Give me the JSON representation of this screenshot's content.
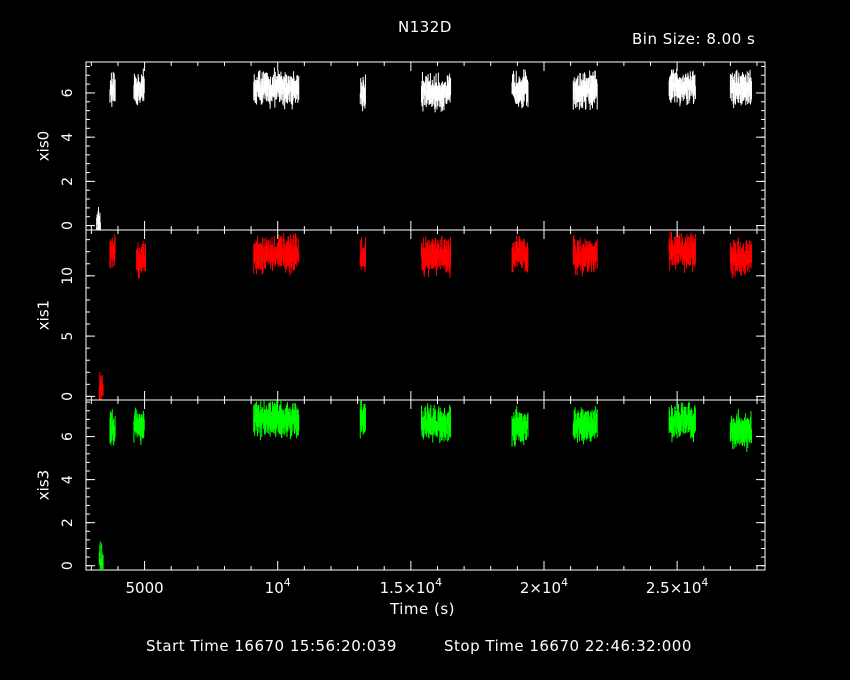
{
  "title": "N132D",
  "bin_label": "Bin Size: 8.00 s",
  "footer": {
    "start": "Start Time 16670 15:56:20:039",
    "stop": "Stop Time 16670 22:46:32:000"
  },
  "colors": {
    "xis0": "#ffffff",
    "xis1": "#ff0000",
    "xis3": "#00ff00"
  },
  "chart_data": {
    "type": "scatter",
    "title": "N132D",
    "xlabel": "Time (s)",
    "xlim": [
      2800,
      28300
    ],
    "x_ticks": [
      {
        "value": 5000,
        "base": "5000",
        "exp": ""
      },
      {
        "value": 10000,
        "base": "10",
        "exp": "4"
      },
      {
        "value": 15000,
        "base": "1.5×10",
        "exp": "4"
      },
      {
        "value": 20000,
        "base": "2×10",
        "exp": "4"
      },
      {
        "value": 25000,
        "base": "2.5×10",
        "exp": "4"
      }
    ],
    "panels": [
      {
        "name": "xis0",
        "ylabel": "xis0",
        "color": "#ffffff",
        "ylim": [
          -0.2,
          7.4
        ],
        "yticks": [
          0,
          2,
          4,
          6
        ],
        "segments": [
          {
            "t": [
              3200,
              3350
            ],
            "y": 0.0
          },
          {
            "t": [
              3700,
              3900
            ],
            "y": 6.0
          },
          {
            "t": [
              4600,
              5000
            ],
            "y": 6.2
          },
          {
            "t": [
              9100,
              10800
            ],
            "y": 6.2
          },
          {
            "t": [
              13100,
              13300
            ],
            "y": 6.0
          },
          {
            "t": [
              15400,
              16500
            ],
            "y": 6.0
          },
          {
            "t": [
              18800,
              19400
            ],
            "y": 6.2
          },
          {
            "t": [
              21100,
              22000
            ],
            "y": 6.1
          },
          {
            "t": [
              24700,
              25700
            ],
            "y": 6.3
          },
          {
            "t": [
              27000,
              27800
            ],
            "y": 6.2
          }
        ]
      },
      {
        "name": "xis1",
        "ylabel": "xis1",
        "color": "#ff0000",
        "ylim": [
          -0.3,
          13.8
        ],
        "yticks": [
          0,
          5,
          10
        ],
        "segments": [
          {
            "t": [
              3300,
              3450
            ],
            "y": 0.6
          },
          {
            "t": [
              3700,
              3900
            ],
            "y": 12.0
          },
          {
            "t": [
              4700,
              5050
            ],
            "y": 11.4
          },
          {
            "t": [
              9100,
              10800
            ],
            "y": 11.8
          },
          {
            "t": [
              13100,
              13300
            ],
            "y": 11.6
          },
          {
            "t": [
              15400,
              16500
            ],
            "y": 11.6
          },
          {
            "t": [
              18800,
              19400
            ],
            "y": 11.8
          },
          {
            "t": [
              21100,
              22000
            ],
            "y": 11.7
          },
          {
            "t": [
              24700,
              25700
            ],
            "y": 12.0
          },
          {
            "t": [
              27000,
              27800
            ],
            "y": 11.5
          }
        ]
      },
      {
        "name": "xis3",
        "ylabel": "xis3",
        "color": "#00ff00",
        "ylim": [
          -0.2,
          7.7
        ],
        "yticks": [
          0,
          2,
          4,
          6
        ],
        "segments": [
          {
            "t": [
              3300,
              3450
            ],
            "y": 0.2
          },
          {
            "t": [
              3700,
              3900
            ],
            "y": 6.4
          },
          {
            "t": [
              4600,
              5000
            ],
            "y": 6.5
          },
          {
            "t": [
              9100,
              10800
            ],
            "y": 6.8
          },
          {
            "t": [
              13100,
              13300
            ],
            "y": 6.9
          },
          {
            "t": [
              15400,
              16500
            ],
            "y": 6.6
          },
          {
            "t": [
              18800,
              19400
            ],
            "y": 6.5
          },
          {
            "t": [
              21100,
              22000
            ],
            "y": 6.5
          },
          {
            "t": [
              24700,
              25700
            ],
            "y": 6.7
          },
          {
            "t": [
              27000,
              27800
            ],
            "y": 6.3
          }
        ]
      }
    ]
  }
}
